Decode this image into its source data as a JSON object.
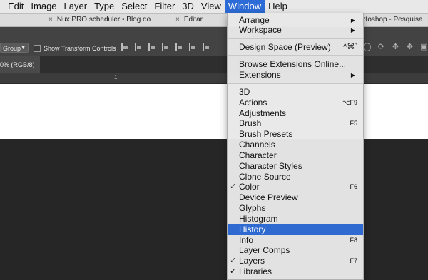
{
  "menubar": {
    "items": [
      "Edit",
      "Image",
      "Layer",
      "Type",
      "Select",
      "Filter",
      "3D",
      "View",
      "Window",
      "Help"
    ],
    "active": "Window"
  },
  "browser_tabs": [
    {
      "title": "Nux PRO scheduler • Blog do",
      "close": "×"
    },
    {
      "title": "Editar",
      "close": "×"
    },
    {
      "title": "otoshop - Pesquisa",
      "close": ""
    }
  ],
  "options": {
    "group_label": "Group",
    "show_transform_label": "Show Transform Controls"
  },
  "document": {
    "tab_label": "0% (RGB/8)",
    "ruler_tick": "1"
  },
  "window_menu": {
    "group1": [
      {
        "label": "Arrange",
        "submenu": true
      },
      {
        "label": "Workspace",
        "submenu": true
      }
    ],
    "group2": [
      {
        "label": "Design Space (Preview)",
        "shortcut": "^⌘`"
      }
    ],
    "group3": [
      {
        "label": "Browse Extensions Online...",
        "submenu": false
      },
      {
        "label": "Extensions",
        "submenu": true
      }
    ],
    "group4": [
      {
        "label": "3D",
        "shortcut": "",
        "checked": false
      },
      {
        "label": "Actions",
        "shortcut": "⌥F9",
        "checked": false
      },
      {
        "label": "Adjustments",
        "shortcut": "",
        "checked": false
      },
      {
        "label": "Brush",
        "shortcut": "F5",
        "checked": false
      },
      {
        "label": "Brush Presets",
        "shortcut": "",
        "checked": false
      },
      {
        "label": "Channels",
        "shortcut": "",
        "checked": false
      },
      {
        "label": "Character",
        "shortcut": "",
        "checked": false
      },
      {
        "label": "Character Styles",
        "shortcut": "",
        "checked": false
      },
      {
        "label": "Clone Source",
        "shortcut": "",
        "checked": false
      },
      {
        "label": "Color",
        "shortcut": "F6",
        "checked": true
      },
      {
        "label": "Device Preview",
        "shortcut": "",
        "checked": false
      },
      {
        "label": "Glyphs",
        "shortcut": "",
        "checked": false
      },
      {
        "label": "Histogram",
        "shortcut": "",
        "checked": false
      },
      {
        "label": "History",
        "shortcut": "",
        "checked": false,
        "highlighted": true
      },
      {
        "label": "Info",
        "shortcut": "F8",
        "checked": false
      },
      {
        "label": "Layer Comps",
        "shortcut": "",
        "checked": false
      },
      {
        "label": "Layers",
        "shortcut": "F7",
        "checked": true
      },
      {
        "label": "Libraries",
        "shortcut": "",
        "checked": true
      }
    ]
  },
  "glyphs": {
    "check": "✓",
    "arrow": "▶",
    "chevron": "⌃"
  }
}
